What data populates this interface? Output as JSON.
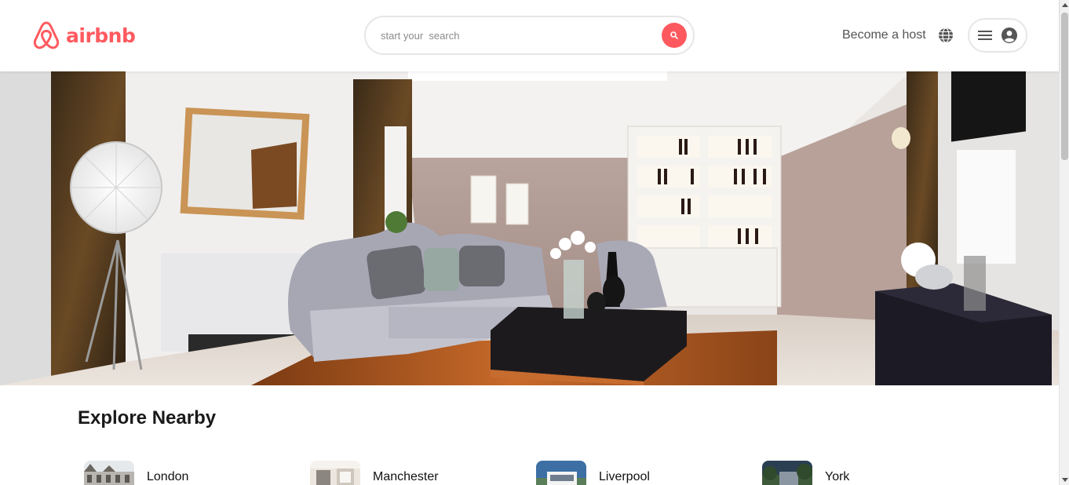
{
  "brand": {
    "name": "airbnb",
    "color": "#FF5A5F"
  },
  "search": {
    "placeholder": "start your  search",
    "button_icon": "search-icon"
  },
  "nav": {
    "host_label": "Become a host",
    "globe_icon": "globe-icon",
    "menu_icon": "hamburger-menu-icon",
    "user_icon": "user-avatar-icon"
  },
  "hero": {
    "image": "living-room-interior"
  },
  "explore": {
    "title": "Explore Nearby",
    "items": [
      {
        "label": "London",
        "thumb": "london-thumbnail"
      },
      {
        "label": "Manchester",
        "thumb": "manchester-thumbnail"
      },
      {
        "label": "Liverpool",
        "thumb": "liverpool-thumbnail"
      },
      {
        "label": "York",
        "thumb": "york-thumbnail"
      }
    ]
  },
  "colors": {
    "accent": "#FE595E",
    "text": "#1a1a1a",
    "muted": "#555555",
    "border": "#e6e6e6"
  }
}
